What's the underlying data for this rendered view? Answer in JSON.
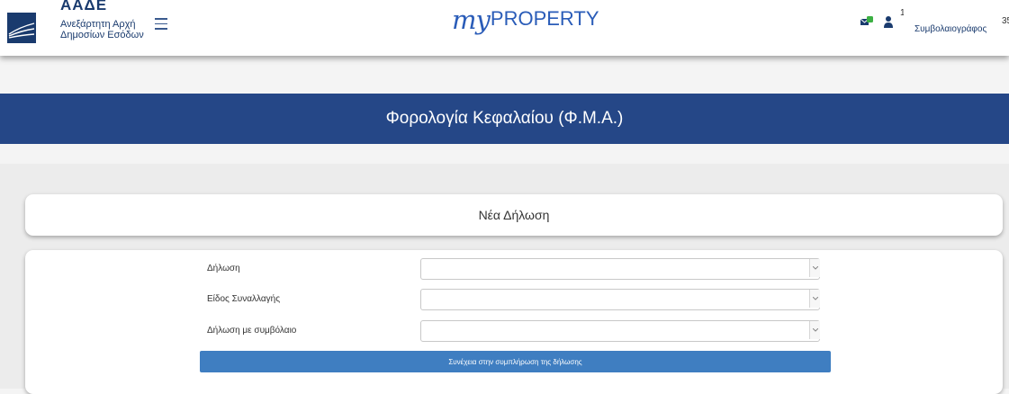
{
  "header": {
    "org_abbr": "ΑΑΔΕ",
    "org_line1": "Ανεξάρτητη Αρχή",
    "org_line2": "Δημοσίων Εσόδων",
    "app_name_my": "my",
    "app_name_rest": "PROPERTY",
    "user_id": "1",
    "user_role": "Συμβολαιογράφος",
    "truncated_number": "35",
    "icons": [
      "aade-logo-icon",
      "hamburger-menu-icon",
      "mail-icon",
      "user-icon"
    ],
    "colors": {
      "brand": "#1a3b6e",
      "app": "#2a5cb8",
      "badge": "#3cb043"
    }
  },
  "title_band": {
    "title": "Φορολογία Κεφαλαίου (Φ.Μ.Α.)",
    "color": "#254787"
  },
  "declaration": {
    "card_title": "Νέα Δήλωση",
    "fields": [
      {
        "label": "Δήλωση",
        "value": ""
      },
      {
        "label": "Είδος Συναλλαγής",
        "value": ""
      },
      {
        "label": "Δήλωση με συμβόλαιο",
        "value": ""
      }
    ],
    "continue_label": "Συνέχεια στην συμπλήρωση της δήλωσης",
    "button_color": "#3f7ec1"
  }
}
